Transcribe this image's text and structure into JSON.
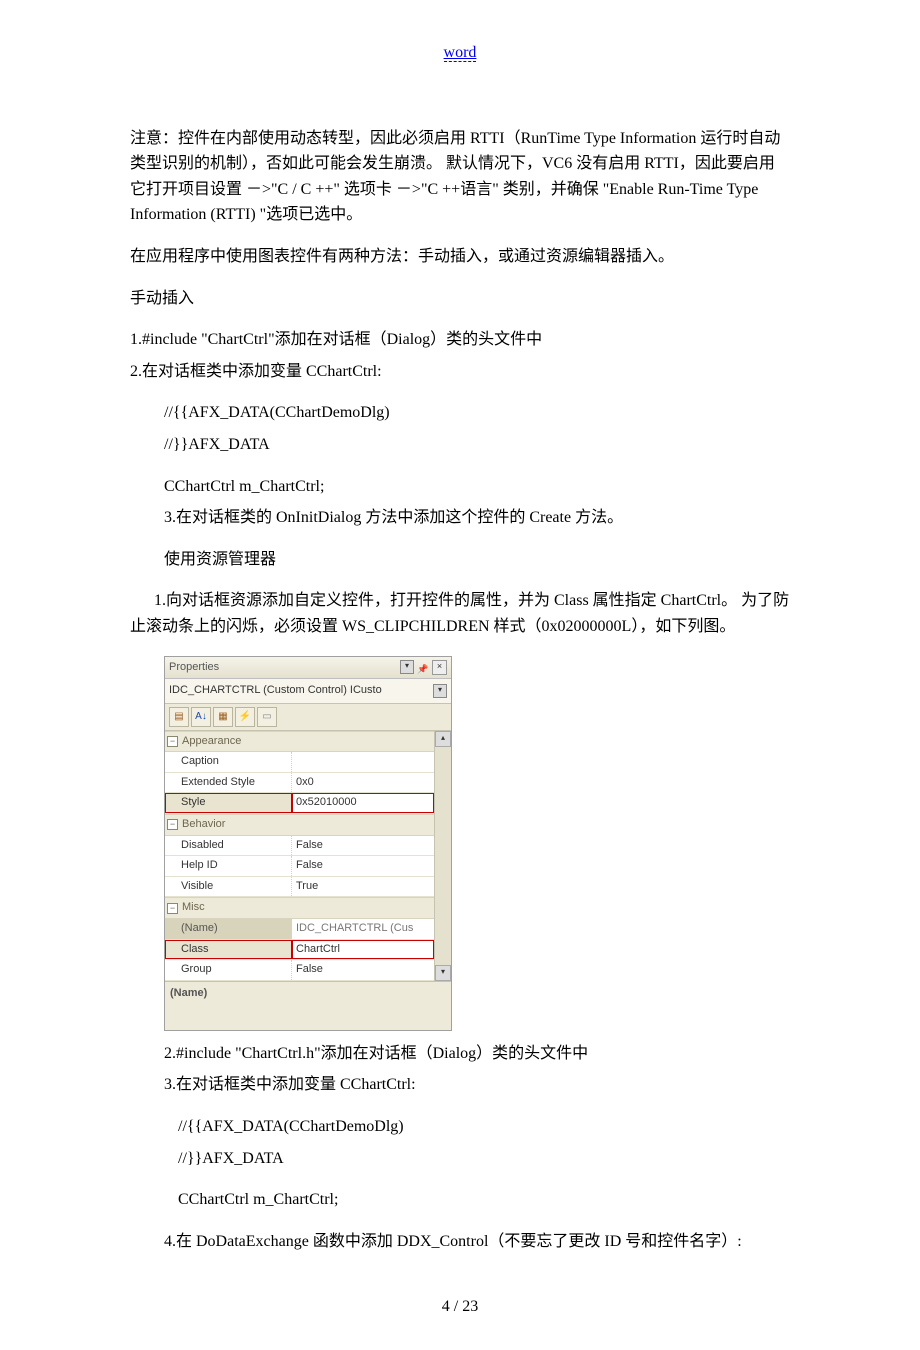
{
  "header_link": "word",
  "para1": "注意：控件在内部使用动态转型，因此必须启用 RTTI（RunTime Type Information 运行时自动类型识别的机制），否如此可能会发生崩溃。  默认情况下，VC6 没有启用 RTTI，因此要启用它打开项目设置 －>\"C / C ++\" 选项卡 －>\"C ++语言\" 类别，并确保 \"Enable Run-Time Type Information (RTTI) \"选项已选中。",
  "para2": "在应用程序中使用图表控件有两种方法：手动插入，或通过资源编辑器插入。",
  "heading_manual": "手动插入",
  "m1": "1.#include \"ChartCtrl\"添加在对话框（Dialog）类的头文件中",
  "m2": "2.在对话框类中添加变量 CChartCtrl:",
  "code_afx_open": "//{{AFX_DATA(CChartDemoDlg)",
  "code_afx_close": "//}}AFX_DATA",
  "code_member": "CChartCtrl m_ChartCtrl;",
  "m3": "3.在对话框类的 OnInitDialog 方法中添加这个控件的 Create 方法。",
  "heading_res": "使用资源管理器",
  "r1": "      1.向对话框资源添加自定义控件，打开控件的属性，并为 Class 属性指定 ChartCtrl。 为了防止滚动条上的闪烁，必须设置 WS_CLIPCHILDREN 样式（0x02000000L），如下列图。",
  "r2": "2.#include \"ChartCtrl.h\"添加在对话框（Dialog）类的头文件中",
  "r3": "3.在对话框类中添加变量 CChartCtrl:",
  "r4": "4.在 DoDataExchange 函数中添加 DDX_Control（不要忘了更改 ID 号和控件名字）:",
  "props": {
    "title": "Properties",
    "combo": "IDC_CHARTCTRL (Custom Control) ICusto",
    "cat_appearance": "Appearance",
    "cat_behavior": "Behavior",
    "cat_misc": "Misc",
    "rows": {
      "caption_k": "Caption",
      "caption_v": "",
      "ext_k": "Extended Style",
      "ext_v": "0x0",
      "style_k": "Style",
      "style_v": "0x52010000",
      "disabled_k": "Disabled",
      "disabled_v": "False",
      "help_k": "Help ID",
      "help_v": "False",
      "visible_k": "Visible",
      "visible_v": "True",
      "name_k": "(Name)",
      "name_v": "IDC_CHARTCTRL (Cus",
      "class_k": "Class",
      "class_v": "ChartCtrl",
      "group_k": "Group",
      "group_v": "False"
    },
    "desc": "(Name)"
  },
  "footer": "4  /  23"
}
